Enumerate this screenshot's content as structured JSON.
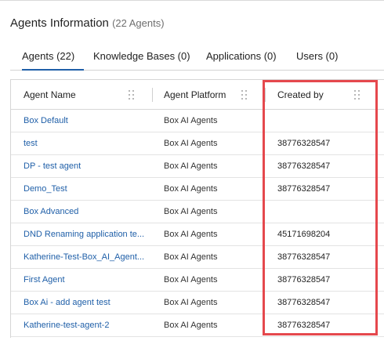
{
  "heading": {
    "title": "Agents Information",
    "count": "(22 Agents)"
  },
  "tabs": [
    {
      "label": "Agents (22)",
      "active": true
    },
    {
      "label": "Knowledge Bases (0)",
      "active": false
    },
    {
      "label": "Applications (0)",
      "active": false
    },
    {
      "label": "Users (0)",
      "active": false
    }
  ],
  "columns": {
    "agent_name": "Agent Name",
    "agent_platform": "Agent Platform",
    "created_by": "Created by"
  },
  "rows": [
    {
      "name": "Box Default",
      "platform": "Box AI Agents",
      "created_by": ""
    },
    {
      "name": "test",
      "platform": "Box AI Agents",
      "created_by": "38776328547"
    },
    {
      "name": "DP - test agent",
      "platform": "Box AI Agents",
      "created_by": "38776328547"
    },
    {
      "name": "Demo_Test",
      "platform": "Box AI Agents",
      "created_by": "38776328547"
    },
    {
      "name": "Box Advanced",
      "platform": "Box AI Agents",
      "created_by": ""
    },
    {
      "name": "DND Renaming application te...",
      "platform": "Box AI Agents",
      "created_by": "45171698204"
    },
    {
      "name": "Katherine-Test-Box_AI_Agent...",
      "platform": "Box AI Agents",
      "created_by": "38776328547"
    },
    {
      "name": "First Agent",
      "platform": "Box AI Agents",
      "created_by": "38776328547"
    },
    {
      "name": "Box Ai - add agent test",
      "platform": "Box AI Agents",
      "created_by": "38776328547"
    },
    {
      "name": "Katherine-test-agent-2",
      "platform": "Box AI Agents",
      "created_by": "38776328547"
    }
  ],
  "colors": {
    "link": "#1f5fa8",
    "highlight": "#e5484d",
    "tab_underline": "#1f5fa8"
  },
  "icons": {
    "column_drag_handle": "drag-handle-icon"
  }
}
